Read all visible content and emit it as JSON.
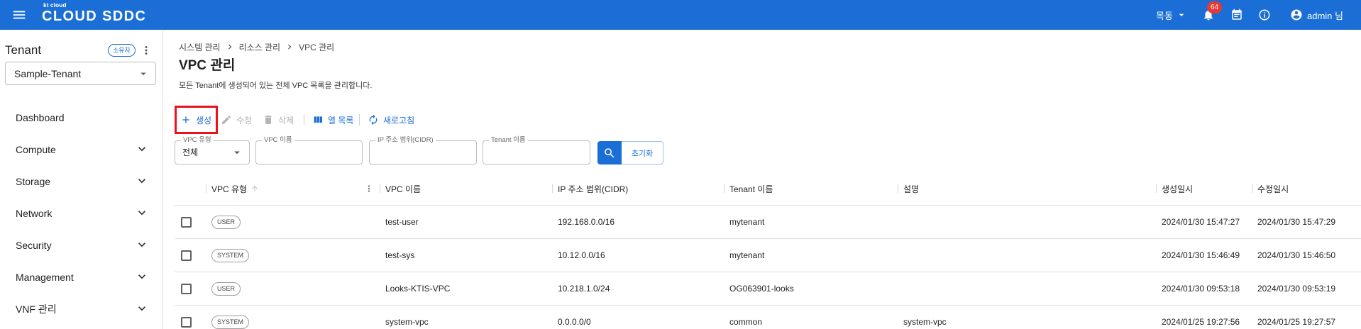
{
  "colors": {
    "brand": "#1a6ed6",
    "notification_badge": "#e53935",
    "highlight": "#e8131b",
    "disabled": "#b5b5b5"
  },
  "header": {
    "logo_small": "kt cloud",
    "logo_main": "CLOUD SDDC",
    "location": "목동",
    "notification_count": "64",
    "user": "admin 님"
  },
  "sidebar": {
    "title": "Tenant",
    "role_badge": "소유자",
    "tenant_select": "Sample-Tenant",
    "items": [
      {
        "label": "Dashboard"
      },
      {
        "label": "Compute"
      },
      {
        "label": "Storage"
      },
      {
        "label": "Network"
      },
      {
        "label": "Security"
      },
      {
        "label": "Management"
      },
      {
        "label": "VNF 관리"
      }
    ]
  },
  "breadcrumb": [
    "시스템 관리",
    "리소스 관리",
    "VPC 관리"
  ],
  "page": {
    "title": "VPC 관리",
    "description": "모든 Tenant에 생성되어 있는 전체 VPC 목록을 관리합니다."
  },
  "toolbar": {
    "create": "생성",
    "edit": "수정",
    "delete": "삭제",
    "columns": "열 목록",
    "refresh": "새로고침"
  },
  "filters": {
    "vpc_type": {
      "label": "VPC 유형",
      "value": "전체"
    },
    "vpc_name": {
      "label": "VPC 이름",
      "value": ""
    },
    "cidr": {
      "label": "IP 주소 범위(CIDR)",
      "value": ""
    },
    "tenant_name": {
      "label": "Tenant 이름",
      "value": ""
    },
    "reset": "초기화"
  },
  "table": {
    "columns": [
      "VPC 유형",
      "VPC 이름",
      "IP 주소 범위(CIDR)",
      "Tenant 이름",
      "설명",
      "생성일시",
      "수정일시"
    ],
    "rows": [
      {
        "type": "USER",
        "name": "test-user",
        "cidr": "192.168.0.0/16",
        "tenant": "mytenant",
        "description": "",
        "created": "2024/01/30 15:47:27",
        "modified": "2024/01/30 15:47:29"
      },
      {
        "type": "SYSTEM",
        "name": "test-sys",
        "cidr": "10.12.0.0/16",
        "tenant": "mytenant",
        "description": "",
        "created": "2024/01/30 15:46:49",
        "modified": "2024/01/30 15:46:50"
      },
      {
        "type": "USER",
        "name": "Looks-KTIS-VPC",
        "cidr": "10.218.1.0/24",
        "tenant": "OG063901-looks",
        "description": "",
        "created": "2024/01/30 09:53:18",
        "modified": "2024/01/30 09:53:19"
      },
      {
        "type": "SYSTEM",
        "name": "system-vpc",
        "cidr": "0.0.0.0/0",
        "tenant": "common",
        "description": "system-vpc",
        "created": "2024/01/25 19:27:56",
        "modified": "2024/01/25 19:27:57"
      }
    ]
  }
}
